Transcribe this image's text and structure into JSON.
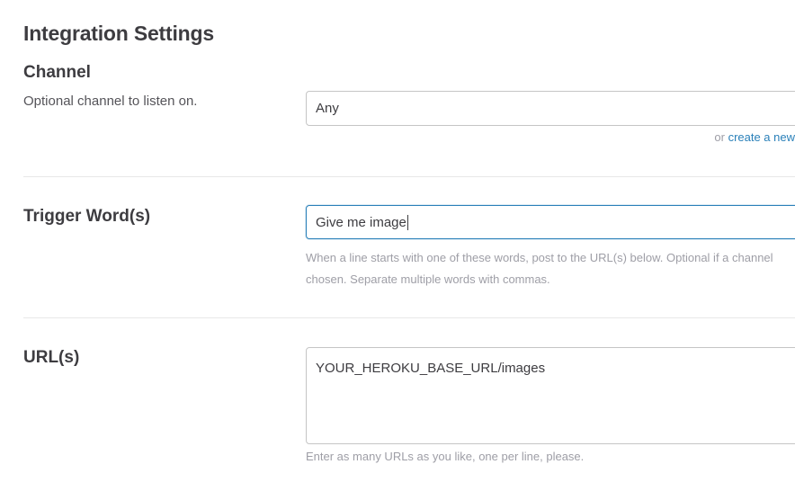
{
  "page": {
    "title": "Integration Settings"
  },
  "channel": {
    "title": "Channel",
    "description": "Optional channel to listen on.",
    "value": "Any",
    "create_prefix": "or",
    "create_link": "create a new"
  },
  "trigger": {
    "title": "Trigger Word(s)",
    "value": "Give me image",
    "help_line1": "When a line starts with one of these words, post to the URL(s) below. Optional if a channel",
    "help_line2": "chosen. Separate multiple words with commas."
  },
  "urls": {
    "title": "URL(s)",
    "value": "YOUR_HEROKU_BASE_URL/images",
    "help": "Enter as many URLs as you like, one per line, please."
  },
  "colors": {
    "link": "#2a80b9",
    "focus_border": "#2a80b9",
    "helper_text": "#9e9ea6",
    "heading_text": "#3d3c40"
  }
}
